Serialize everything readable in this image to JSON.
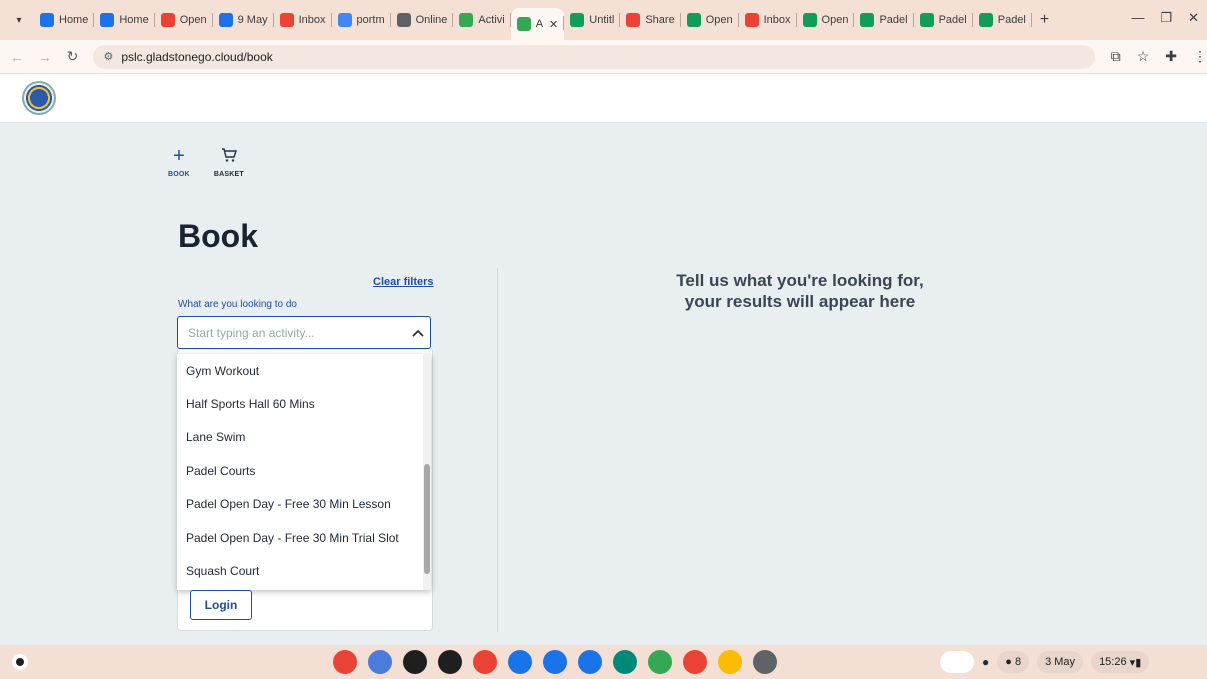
{
  "browser": {
    "tabs": [
      {
        "label": "Home",
        "fav_color": "#1a73e8",
        "fav_icon": "drive-icon"
      },
      {
        "label": "Home",
        "fav_color": "#1a73e8",
        "fav_icon": "drive-icon"
      },
      {
        "label": "Open",
        "fav_color": "#ea4335",
        "fav_icon": "gmail-icon"
      },
      {
        "label": "9 May",
        "fav_color": "#1a73e8",
        "fav_icon": "forms-icon"
      },
      {
        "label": "Inbox",
        "fav_color": "#ea4335",
        "fav_icon": "gmail-icon"
      },
      {
        "label": "portm",
        "fav_color": "#4285f4",
        "fav_icon": "google-icon"
      },
      {
        "label": "Online",
        "fav_color": "#5f6368",
        "fav_icon": "globe-icon"
      },
      {
        "label": "Activi",
        "fav_color": "#34a853",
        "fav_icon": "activity-icon"
      },
      {
        "label": "A",
        "fav_color": "#34a853",
        "fav_icon": "activity-icon",
        "active": true
      },
      {
        "label": "Untitl",
        "fav_color": "#0f9d58",
        "fav_icon": "sheets-icon"
      },
      {
        "label": "Share",
        "fav_color": "#ea4335",
        "fav_icon": "gmail-icon"
      },
      {
        "label": "Open",
        "fav_color": "#0f9d58",
        "fav_icon": "sheets-icon"
      },
      {
        "label": "Inbox",
        "fav_color": "#ea4335",
        "fav_icon": "gmail-icon"
      },
      {
        "label": "Open",
        "fav_color": "#0f9d58",
        "fav_icon": "sheets-icon"
      },
      {
        "label": "Padel",
        "fav_color": "#0f9d58",
        "fav_icon": "sheets-icon"
      },
      {
        "label": "Padel",
        "fav_color": "#0f9d58",
        "fav_icon": "sheets-icon"
      },
      {
        "label": "Padel",
        "fav_color": "#0f9d58",
        "fav_icon": "sheets-icon"
      }
    ],
    "url": "pslc.gladstonego.cloud/book"
  },
  "nav": {
    "book_label": "BOOK",
    "basket_label": "BASKET"
  },
  "page": {
    "title": "Book",
    "clear_filters": "Clear filters",
    "field_label": "What are you looking to do",
    "placeholder": "Start typing an activity...",
    "options": [
      "Gym Workout",
      "Half Sports Hall 60 Mins",
      "Lane Swim",
      "Padel Courts",
      "Padel Open Day - Free 30 Min Lesson",
      "Padel Open Day - Free 30 Min Trial Slot",
      "Squash Court"
    ],
    "login_label": "Login",
    "results_line1": "Tell us what you're looking for,",
    "results_line2": "your results will appear here"
  },
  "shelf": {
    "apps": [
      {
        "name": "chrome-icon",
        "color": "#ea4335"
      },
      {
        "name": "gemini-icon",
        "color": "#4c7bdb"
      },
      {
        "name": "podcast-icon",
        "color": "#1f1f1f"
      },
      {
        "name": "apps-icon",
        "color": "#1f1f1f"
      },
      {
        "name": "gmail-icon",
        "color": "#ea4335"
      },
      {
        "name": "calendar-icon",
        "color": "#1a73e8"
      },
      {
        "name": "files-icon",
        "color": "#1a73e8"
      },
      {
        "name": "messages-icon",
        "color": "#1a73e8"
      },
      {
        "name": "meet-icon",
        "color": "#00897b"
      },
      {
        "name": "play-store-icon",
        "color": "#34a853"
      },
      {
        "name": "youtube-icon",
        "color": "#ea4335"
      },
      {
        "name": "photos-icon",
        "color": "#fbbc04"
      },
      {
        "name": "settings-icon",
        "color": "#5f6368"
      }
    ],
    "notification_count": "8",
    "date": "3 May",
    "time": "15:26"
  }
}
